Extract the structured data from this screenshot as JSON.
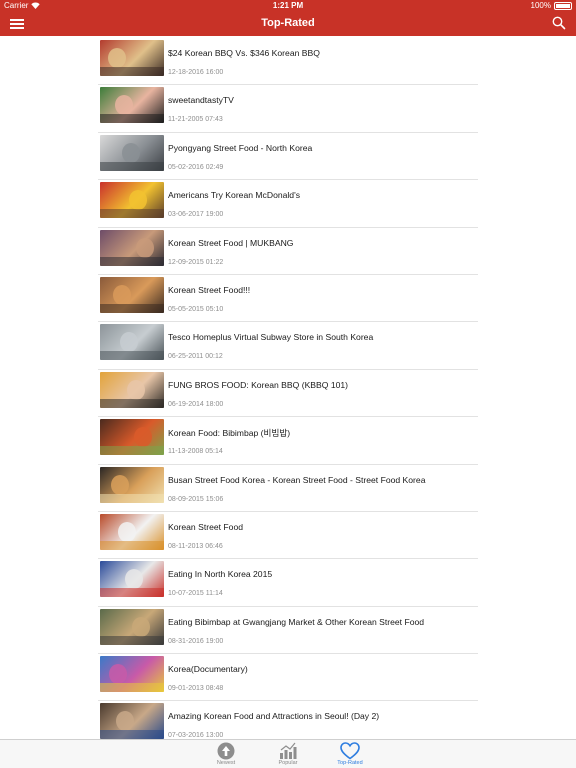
{
  "status_bar": {
    "carrier": "Carrier",
    "time": "1:21 PM",
    "battery": "100%"
  },
  "nav": {
    "title": "Top-Rated",
    "menu_icon": "hamburger-menu-icon",
    "search_icon": "search-icon"
  },
  "videos": [
    {
      "title": "$24 Korean BBQ Vs. $346 Korean BBQ",
      "date": "12-18-2016 16:00",
      "thumb_colors": [
        "#b33b2e",
        "#e0c08a",
        "#3a2a24"
      ]
    },
    {
      "title": "sweetandtastyTV",
      "date": "11-21-2005 07:43",
      "thumb_colors": [
        "#3c7d3a",
        "#e8b4a0",
        "#1e1e1e"
      ]
    },
    {
      "title": "Pyongyang Street Food - North Korea",
      "date": "05-02-2016 02:49",
      "thumb_colors": [
        "#d9d9d9",
        "#8a8f94",
        "#3b3f44"
      ]
    },
    {
      "title": "Americans Try Korean McDonald's",
      "date": "03-06-2017 19:00",
      "thumb_colors": [
        "#c9302c",
        "#f2c230",
        "#5a3d2b"
      ]
    },
    {
      "title": "Korean Street Food  | MUKBANG",
      "date": "12-09-2015 01:22",
      "thumb_colors": [
        "#6d4c68",
        "#c89a7a",
        "#2d2b33"
      ]
    },
    {
      "title": "Korean Street Food!!!",
      "date": "05-05-2015 05:10",
      "thumb_colors": [
        "#8a5a3a",
        "#d99a5a",
        "#3a2a20"
      ]
    },
    {
      "title": "Tesco Homeplus Virtual Subway Store in South Korea",
      "date": "06-25-2011 00:12",
      "thumb_colors": [
        "#8d959a",
        "#c7cdd1",
        "#4b5459"
      ]
    },
    {
      "title": "FUNG BROS FOOD: Korean BBQ (KBBQ 101)",
      "date": "06-19-2014 18:00",
      "thumb_colors": [
        "#e2a33a",
        "#e8c6a8",
        "#2e2a26"
      ]
    },
    {
      "title": "Korean Food: Bibimbap (비빔밥)",
      "date": "11-13-2008 05:14",
      "thumb_colors": [
        "#4a2a1e",
        "#d95a2a",
        "#7ea34a"
      ]
    },
    {
      "title": "Busan Street Food Korea - Korean Street Food - Street Food Korea",
      "date": "08-09-2015 15:06",
      "thumb_colors": [
        "#2a2624",
        "#d9a05a",
        "#f0e0b0"
      ]
    },
    {
      "title": "Korean Street Food",
      "date": "08-11-2013 06:46",
      "thumb_colors": [
        "#b84a2a",
        "#f2f2f2",
        "#d9902a"
      ]
    },
    {
      "title": "Eating In North Korea  2015",
      "date": "10-07-2015 11:14",
      "thumb_colors": [
        "#2a4a9a",
        "#e8e8e8",
        "#c8302a"
      ]
    },
    {
      "title": "Eating Bibimbap at Gwangjang Market & Other Korean Street Food",
      "date": "08-31-2016 19:00",
      "thumb_colors": [
        "#5a6a4a",
        "#c8a878",
        "#3a3a3a"
      ]
    },
    {
      "title": "Korea(Documentary)",
      "date": "09-01-2013 08:48",
      "thumb_colors": [
        "#3a7ac8",
        "#c85aa8",
        "#e8c83a"
      ]
    },
    {
      "title": "Amazing Korean Food and Attractions in Seoul! (Day 2)",
      "date": "07-03-2016 13:00",
      "thumb_colors": [
        "#4a3a2e",
        "#c8a888",
        "#2a4a8a"
      ]
    }
  ],
  "tabs": [
    {
      "label": "Newest",
      "icon": "up-arrow-circle-icon",
      "active": false
    },
    {
      "label": "Popular",
      "icon": "bar-chart-icon",
      "active": false
    },
    {
      "label": "Top-Rated",
      "icon": "heart-icon",
      "active": true
    }
  ],
  "colors": {
    "brand_red": "#c83227",
    "active_tab": "#2f7ee0",
    "inactive_tab": "#888888"
  }
}
